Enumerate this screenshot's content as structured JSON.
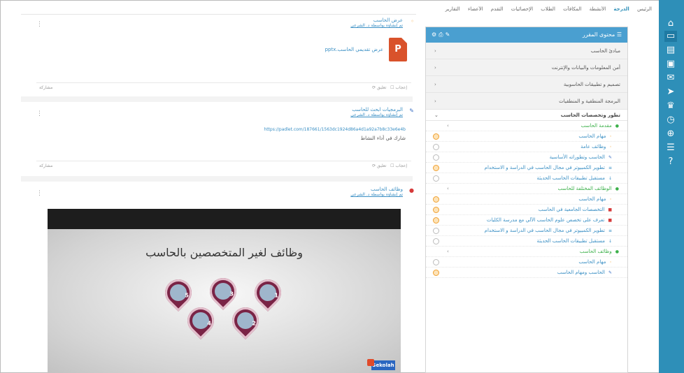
{
  "nav": {
    "items": [
      "الرئيس",
      "الدرجة",
      "الأنشطة",
      "المكافآت",
      "الطلاب",
      "الإحصائيات",
      "التقدم",
      "الأعضاء",
      "التقارير"
    ],
    "active_index": 1
  },
  "sidebar": {
    "title": "محتوى المقرر",
    "sections_closed": [
      "مبادئ الحاسب",
      "أمن المعلومات والبيانات والإنترنت",
      "تصميم و تطبيقات الحاسوبية",
      "البرمجة المنطقية و المنطقيات"
    ],
    "section_open": "تطور وتخصصات الحاسب",
    "rows": [
      {
        "label": "مقدمة الحاسب",
        "level": 1,
        "bullet": "●",
        "color": "#3cb04a",
        "done": false
      },
      {
        "label": "مهام الحاسب",
        "level": 2,
        "bullet": "◦",
        "color": "#f0a030",
        "done": true
      },
      {
        "label": "وظائف عامة",
        "level": 2,
        "bullet": "◦",
        "color": "#f0a030",
        "done": false
      },
      {
        "label": "الحاسب وتطوراته الأساسية",
        "level": 2,
        "bullet": "✎",
        "color": "#3a6fc4",
        "done": false
      },
      {
        "label": "تطوير الكمبيوتر في مجال الحاسب في الدراسة و الاستخدام",
        "level": 2,
        "bullet": "≡",
        "color": "#3a8fc4",
        "done": true
      },
      {
        "label": "مستقبل تطبيقات الحاسب الحديثة",
        "level": 2,
        "bullet": "↓",
        "color": "#3a8fc4",
        "done": false
      },
      {
        "label": "الوظائف المختلفة للحاسب",
        "level": 1,
        "bullet": "●",
        "color": "#3cb04a",
        "done": false
      },
      {
        "label": "مهام الحاسب",
        "level": 2,
        "bullet": "◦",
        "color": "#f0a030",
        "done": true
      },
      {
        "label": "التخصصات الجامعية في الحاسب",
        "level": 2,
        "bullet": "■",
        "color": "#d63a3a",
        "done": true
      },
      {
        "label": "تعرف على تخصص علوم الحاسب الآلي مع مدرسة الكليات",
        "level": 2,
        "bullet": "■",
        "color": "#d63a3a",
        "done": true
      },
      {
        "label": "تطوير الكمبيوتر في مجال الحاسب في الدراسة و الاستخدام",
        "level": 2,
        "bullet": "≡",
        "color": "#3a8fc4",
        "done": false
      },
      {
        "label": "مستقبل تطبيقات الحاسب الحديثة",
        "level": 2,
        "bullet": "↓",
        "color": "#3a8fc4",
        "done": false
      },
      {
        "label": "وظائف الحاسب",
        "level": 1,
        "bullet": "●",
        "color": "#3cb04a",
        "done": false
      },
      {
        "label": "مهام الحاسب",
        "level": 2,
        "bullet": "◦",
        "color": "#f0a030",
        "done": false
      },
      {
        "label": "الحاسب ومهام الحاسب",
        "level": 2,
        "bullet": "✎",
        "color": "#3a6fc4",
        "done": true
      }
    ]
  },
  "activities": [
    {
      "title": "عرض الحاسب",
      "subtitle": "تم إنشاؤه بواسطة د. الشرعي",
      "file_label": "عرض تقديمي الحاسب.pptx",
      "file_type": "P"
    },
    {
      "title": "البرمجيات ابحث للحاسب",
      "subtitle": "تم إنشاؤه بواسطة د. الشرعي",
      "link": "https://padlet.com/187661/1563dc1924d86a4d1a92a7b8c33e6e4b",
      "note": "شارك في أداء النشاط"
    },
    {
      "title": "وظائف الحاسب",
      "subtitle": "تم إنشاؤه بواسطة د. الشرعي"
    }
  ],
  "action_bar": {
    "like": "إعجاب",
    "comment": "تعليق",
    "share": "مشاركة"
  },
  "slide": {
    "title": "وظائف لغير المتخصصين بالحاسب",
    "pin_numbers": [
      "1",
      "2",
      "3",
      "4",
      "5"
    ],
    "logo_label": "Sekolah"
  },
  "colors": {
    "accent": "#2e8fb8",
    "pin": "#7a2446",
    "ppt": "#d9522b"
  },
  "rail_icons": [
    "home-icon",
    "monitor-icon",
    "book-icon",
    "file-icon",
    "chat-icon",
    "send-icon",
    "trophy-icon",
    "clock-icon",
    "globe-icon",
    "database-icon",
    "help-icon"
  ]
}
